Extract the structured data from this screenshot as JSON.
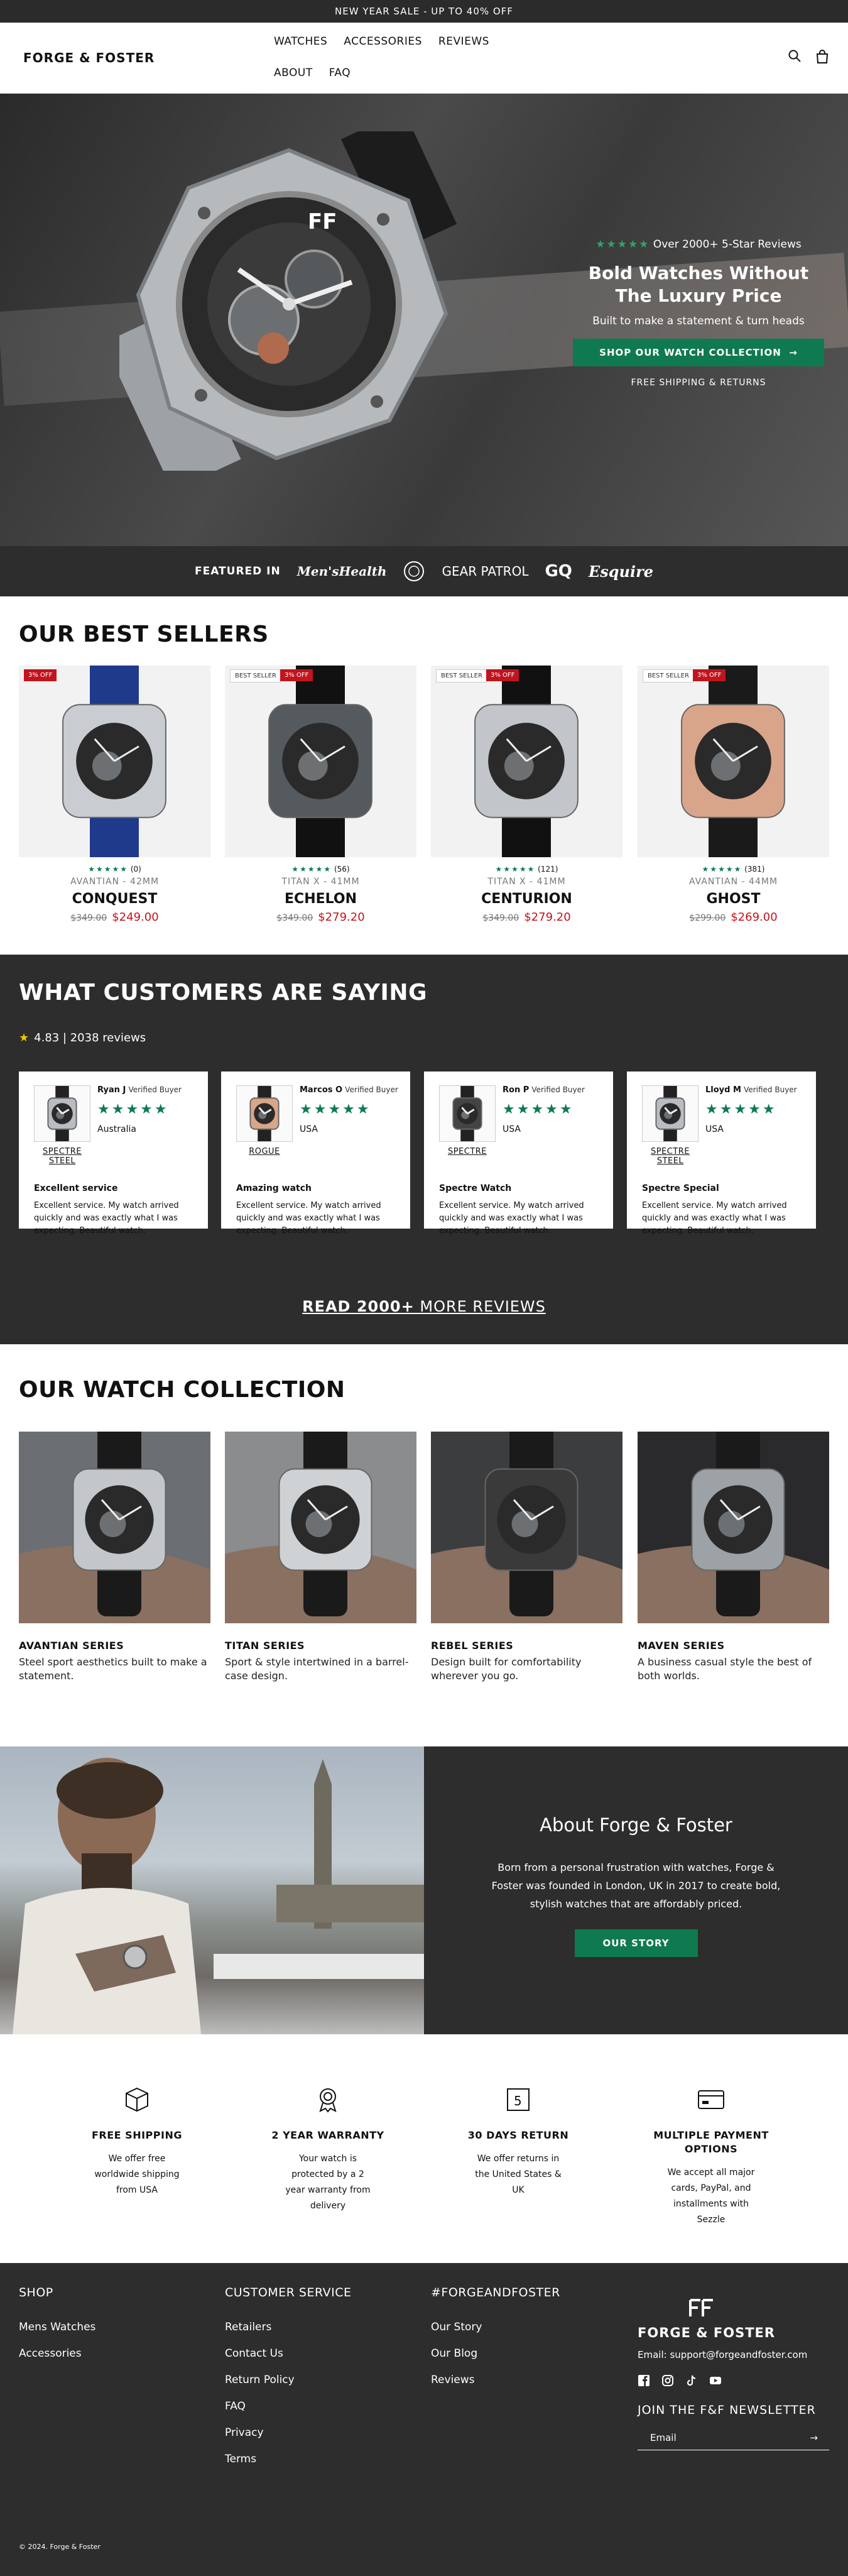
{
  "announcement": "NEW YEAR SALE - UP TO 40% OFF",
  "brand": "FORGE & FOSTER",
  "nav": [
    "WATCHES",
    "ACCESSORIES",
    "REVIEWS",
    "ABOUT",
    "FAQ"
  ],
  "hero": {
    "stars": "★★★★★",
    "reviews_text": "Over 2000+ 5-Star Reviews",
    "title_line1": "Bold Watches Without",
    "title_line2": "The Luxury Price",
    "subtitle": "Built to make a statement & turn heads",
    "cta": "SHOP OUR WATCH COLLECTION",
    "shipping": "FREE SHIPPING & RETURNS"
  },
  "featured": {
    "label": "FEATURED IN",
    "publications": [
      "Men'sHealth",
      "GEAR PATROL",
      "GQ",
      "Esquire"
    ]
  },
  "best_sellers": {
    "title": "OUR BEST SELLERS",
    "products": [
      {
        "badge_seller": "",
        "badge_off": "3% OFF",
        "stars": "★★★★★",
        "count": "(0)",
        "series": "AVANTIAN - 42MM",
        "name": "CONQUEST",
        "old_price": "$349.00",
        "price": "$249.00",
        "strap": "#1f3a8a",
        "case": "#c9cdd2"
      },
      {
        "badge_seller": "BEST SELLER",
        "badge_off": "3% OFF",
        "stars": "★★★★★",
        "count": "(56)",
        "series": "TITAN X - 41MM",
        "name": "ECHELON",
        "old_price": "$349.00",
        "price": "$279.20",
        "strap": "#111111",
        "case": "#555a5e"
      },
      {
        "badge_seller": "BEST SELLER",
        "badge_off": "3% OFF",
        "stars": "★★★★★",
        "count": "(121)",
        "series": "TITAN X - 41MM",
        "name": "CENTURION",
        "old_price": "$349.00",
        "price": "$279.20",
        "strap": "#111111",
        "case": "#c2c6ca"
      },
      {
        "badge_seller": "BEST SELLER",
        "badge_off": "3% OFF",
        "stars": "★★★★★",
        "count": "(381)",
        "series": "AVANTIAN - 44MM",
        "name": "GHOST",
        "old_price": "$299.00",
        "price": "$269.00",
        "strap": "#1a1a1a",
        "case": "#d9a58a"
      }
    ]
  },
  "reviews": {
    "title": "WHAT CUSTOMERS ARE SAYING",
    "rating_star": "★",
    "rating": "4.83 | 2038 reviews",
    "verified": "Verified Buyer",
    "items": [
      {
        "name": "Ryan J",
        "stars": "★★★★★",
        "country": "Australia",
        "watch_line1": "SPECTRE",
        "watch_line2": "STEEL",
        "title": "Excellent service",
        "body": "Excellent service. My watch arrived quickly and was exactly what I was expecting. Beautiful watch.",
        "case": "#b9bdc1"
      },
      {
        "name": "Marcos O",
        "stars": "★★★★★",
        "country": "USA",
        "watch_line1": "ROGUE",
        "watch_line2": "",
        "title": "Amazing watch",
        "body": "Excellent service. My watch arrived quickly and was exactly what I was expecting. Beautiful watch.",
        "case": "#d8a688"
      },
      {
        "name": "Ron P",
        "stars": "★★★★★",
        "country": "USA",
        "watch_line1": "SPECTRE",
        "watch_line2": "",
        "title": "Spectre Watch",
        "body": "Excellent service. My watch arrived quickly and was exactly what I was expecting. Beautiful watch.",
        "case": "#444"
      },
      {
        "name": "Lloyd M",
        "stars": "★★★★★",
        "country": "USA",
        "watch_line1": "SPECTRE",
        "watch_line2": "STEEL",
        "title": "Spectre Special",
        "body": "Excellent service. My watch arrived quickly and was exactly what I was expecting. Beautiful watch.",
        "case": "#b9bdc1"
      }
    ],
    "more_bold": "READ 2000+",
    "more_rest": " MORE REVIEWS"
  },
  "collection": {
    "title": "OUR WATCH COLLECTION",
    "items": [
      {
        "name": "AVANTIAN SERIES",
        "desc": "Steel sport aesthetics built to make a statement.",
        "bg": "#6b6f73",
        "case": "#c3c7cb"
      },
      {
        "name": "TITAN SERIES",
        "desc": "Sport & style intertwined in a barrel-case design.",
        "bg": "#8a8c8e",
        "case": "#cfd2d5"
      },
      {
        "name": "REBEL SERIES",
        "desc": "Design built for comfortability wherever you go.",
        "bg": "#3b3d3f",
        "case": "#3a3a3a"
      },
      {
        "name": "MAVEN SERIES",
        "desc": "A business casual style the best of both worlds.",
        "bg": "#2a2a2c",
        "case": "#9da2a6"
      }
    ]
  },
  "about": {
    "title": "About Forge & Foster",
    "body": "Born from a personal frustration with watches, Forge & Foster was founded in London, UK in 2017 to create bold, stylish watches that are affordably priced.",
    "button": "OUR STORY"
  },
  "features": [
    {
      "icon": "box-icon",
      "title": "FREE SHIPPING",
      "desc": "We offer free worldwide shipping from USA"
    },
    {
      "icon": "award-icon",
      "title": "2 YEAR WARRANTY",
      "desc": "Your watch is protected by a 2 year warranty from delivery"
    },
    {
      "icon": "return-icon",
      "title": "30 DAYS RETURN",
      "desc": "We offer returns in the United States & UK"
    },
    {
      "icon": "card-icon",
      "title": "MULTIPLE PAYMENT OPTIONS",
      "desc": "We accept all major cards, PayPal, and installments with Sezzle"
    }
  ],
  "footer": {
    "shop": {
      "heading": "SHOP",
      "items": [
        "Mens Watches",
        "Accessories"
      ]
    },
    "service": {
      "heading": "CUSTOMER SERVICE",
      "items": [
        "Retailers",
        "Contact Us",
        "Return Policy",
        "FAQ",
        "Privacy",
        "Terms"
      ]
    },
    "social": {
      "heading": "#FORGEANDFOSTER",
      "items": [
        "Our Story",
        "Our Blog",
        "Reviews"
      ]
    },
    "brand": "FORGE & FOSTER",
    "email": "Email: support@forgeandfoster.com",
    "newsletter": "JOIN THE F&F NEWSLETTER",
    "email_placeholder": "Email",
    "copyright": "© 2024. Forge & Foster"
  },
  "colors": {
    "accent_green": "#0f7a4f",
    "sale_red": "#c2141d",
    "dark": "#2d2d2d"
  }
}
